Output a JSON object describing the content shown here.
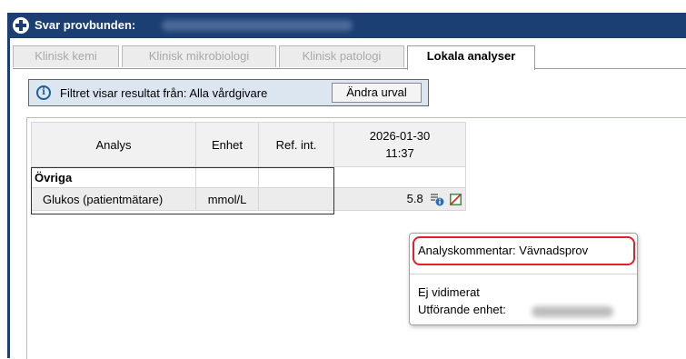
{
  "window": {
    "title": "Svar provbunden:"
  },
  "tabs": [
    {
      "label": "Klinisk kemi",
      "active": false
    },
    {
      "label": "Klinisk mikrobiologi",
      "active": false
    },
    {
      "label": "Klinisk patologi",
      "active": false
    },
    {
      "label": "Lokala analyser",
      "active": true
    }
  ],
  "filter": {
    "text": "Filtret visar resultat från: Alla vårdgivare",
    "button_label": "Ändra urval"
  },
  "table": {
    "headers": {
      "analys": "Analys",
      "enhet": "Enhet",
      "ref": "Ref. int.",
      "date": "2026-01-30",
      "time": "11:37"
    },
    "group": "Övriga",
    "rows": [
      {
        "analys": "Glukos (patientmätare)",
        "enhet": "mmol/L",
        "ref": "",
        "value": "5.8"
      }
    ]
  },
  "icons": {
    "title": "plus-circle-icon",
    "info": "info-icon",
    "comment": "comment-info-icon",
    "not_verified": "not-verified-icon"
  },
  "popup": {
    "comment": "Analyskommentar: Vävnadsprov",
    "status": "Ej vidimerat",
    "unit_label": "Utförande enhet:"
  },
  "colors": {
    "titlebar": "#1b3f73",
    "filterbar": "#dce6f1",
    "highlight": "#e0202a",
    "content_border": "#e9b27c"
  }
}
